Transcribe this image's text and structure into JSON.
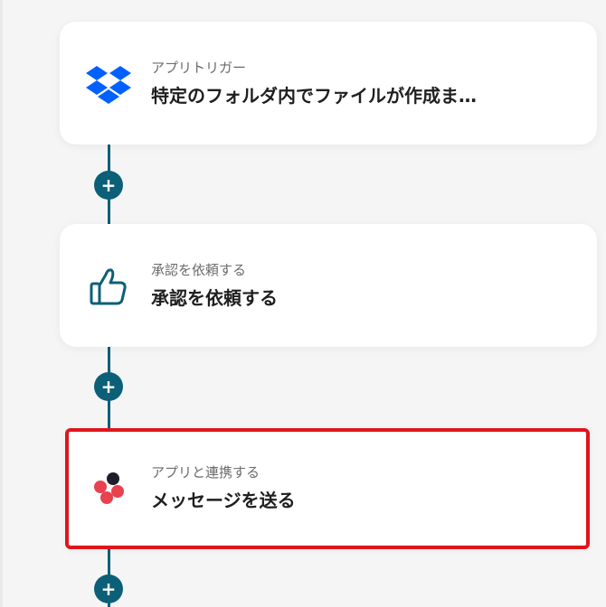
{
  "steps": [
    {
      "subtitle": "アプリトリガー",
      "title": "特定のフォルダ内でファイルが作成ま…",
      "icon": "dropbox-icon"
    },
    {
      "subtitle": "承認を依頼する",
      "title": "承認を依頼する",
      "icon": "thumbs-up-icon"
    },
    {
      "subtitle": "アプリと連携する",
      "title": "メッセージを送る",
      "icon": "chatwork-icon"
    }
  ],
  "add_label": "+",
  "colors": {
    "connector": "#0b6077",
    "highlight": "#e0151c",
    "dropbox": "#0061fe",
    "chatwork_red": "#e8414f",
    "chatwork_dark": "#1d1f2a"
  }
}
